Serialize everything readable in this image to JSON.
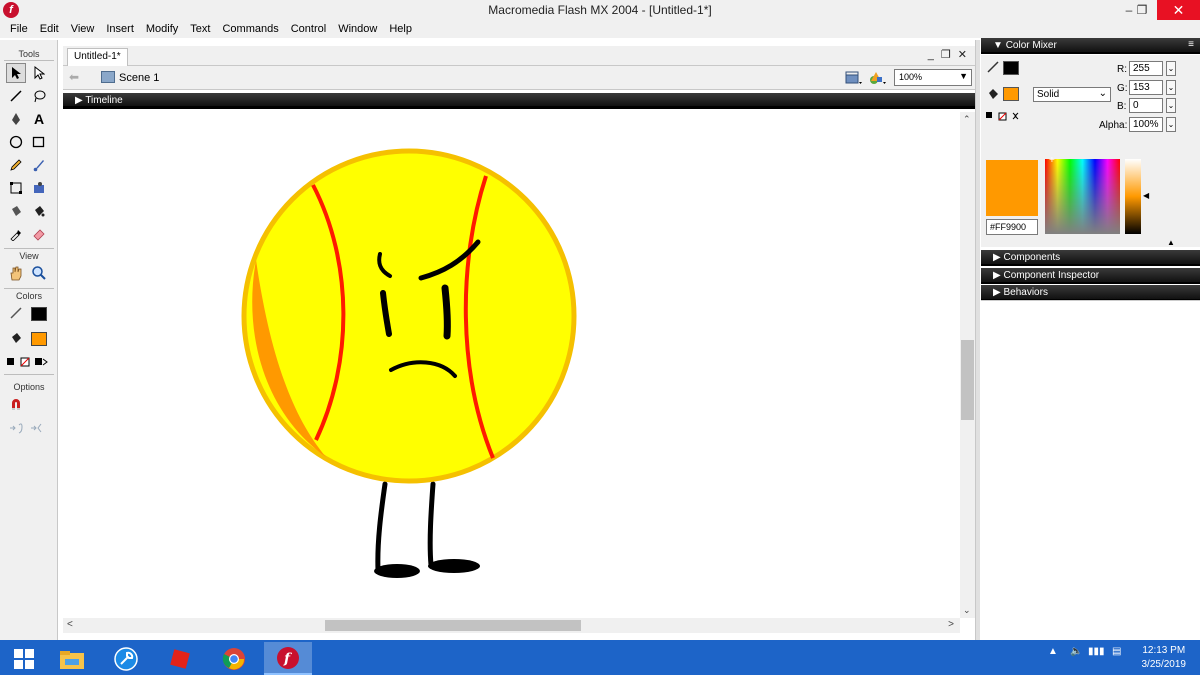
{
  "window": {
    "title": "Macromedia Flash MX 2004 - [Untitled-1*]",
    "app_icon": "flash-logo-icon"
  },
  "menu": [
    "File",
    "Edit",
    "View",
    "Insert",
    "Modify",
    "Text",
    "Commands",
    "Control",
    "Window",
    "Help"
  ],
  "tools_panel": {
    "tools_label": "Tools",
    "view_label": "View",
    "colors_label": "Colors",
    "options_label": "Options",
    "stroke_color": "#000000",
    "fill_color": "#FF9900"
  },
  "document": {
    "tab_label": "Untitled-1*",
    "scene_label": "Scene 1",
    "zoom": "100%",
    "timeline_label": "Timeline"
  },
  "color_mixer": {
    "header": "Color Mixer",
    "r_label": "R:",
    "r_value": "255",
    "g_label": "G:",
    "g_value": "153",
    "b_label": "B:",
    "b_value": "0",
    "alpha_label": "Alpha:",
    "alpha_value": "100%",
    "fill_type": "Solid",
    "hex": "#FF9900",
    "swatch_color": "#FF9900"
  },
  "panels": [
    "Components",
    "Component Inspector",
    "Behaviors"
  ],
  "taskbar": {
    "time": "12:13 PM",
    "date": "3/25/2019"
  }
}
